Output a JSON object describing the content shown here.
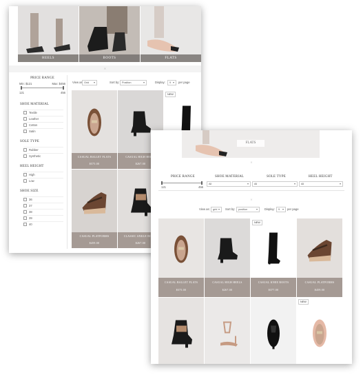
{
  "back": {
    "categories": [
      {
        "label": "HEELS",
        "bg": "#e2e0df"
      },
      {
        "label": "BOOTS",
        "bg": "#bdb7b2"
      },
      {
        "label": "FLATS",
        "bg": "#e8e7e6"
      }
    ],
    "price_range": {
      "title": "PRICE RANGE",
      "min_label": "Min: $121",
      "max_label": "Max: $456",
      "min": "121",
      "max": "456"
    },
    "toolbar": {
      "view_as": "View as:",
      "view_value": "Grid",
      "sort_by": "Sort by:",
      "sort_value": "Position",
      "display": "Display:",
      "display_value": "9",
      "per_page": "per page"
    },
    "filters": [
      {
        "title": "SHOE MATERIAL",
        "options": [
          "Textile",
          "Leather",
          "Cotton",
          "Satin"
        ]
      },
      {
        "title": "SOLE TYPE",
        "options": [
          "Rubber",
          "Synthetic"
        ]
      },
      {
        "title": "HEEL HEIGHT",
        "options": [
          "High",
          "Low"
        ]
      },
      {
        "title": "SHOE SIZE",
        "options": [
          "36",
          "37",
          "38",
          "39",
          "40"
        ]
      }
    ],
    "products": [
      {
        "name": "CASUAL BALLET FLATS",
        "price": "$575.00",
        "bg": "#e4e1df",
        "shoe": "#7a5138",
        "shape": "flat"
      },
      {
        "name": "CASUAL HIGH HEELS",
        "price": "$267.00",
        "bg": "#d9d7d6",
        "shoe": "#1a1a1a",
        "shape": "bootie"
      },
      {
        "name": "",
        "price": "",
        "bg": "#ffffff",
        "shoe": "#111111",
        "shape": "tallboot",
        "badge": "NEW"
      },
      {
        "name": "CASUAL PLATFORMS",
        "price": "$459.00",
        "bg": "#d7d3d0",
        "shoe": "#6b4632",
        "shape": "wedge"
      },
      {
        "name": "CLASSIC ANKLE BOOTS",
        "price": "$267.00",
        "bg": "#e1dedc",
        "shoe": "#1a1a1a",
        "shape": "ankle"
      }
    ]
  },
  "front": {
    "banner_label": "FLATS",
    "filter_bar": {
      "price_range": {
        "title": "PRICE RANGE",
        "min": "121",
        "max": "456"
      },
      "shoe_material": {
        "title": "SHOE MATERIAL",
        "value": "All"
      },
      "sole_type": {
        "title": "SOLE TYPE",
        "value": "All"
      },
      "heel_height": {
        "title": "HEEL HEIGHT",
        "value": "All"
      }
    },
    "toolbar": {
      "view_as": "View as:",
      "view_value": "grid",
      "sort_by": "Sort by:",
      "sort_value": "position",
      "display": "Display:",
      "display_value": "9",
      "per_page": "per page"
    },
    "products": [
      {
        "name": "CASUAL BALLET FLATS",
        "price": "$575.00",
        "bg": "#e8e5e3",
        "shoe": "#7a5138",
        "shape": "flat"
      },
      {
        "name": "CASUAL HIGH HEELS",
        "price": "$267.00",
        "bg": "#dcdad9",
        "shoe": "#1a1a1a",
        "shape": "bootie"
      },
      {
        "name": "CASUAL KNEE BOOTS",
        "price": "$377.00",
        "bg": "#ffffff",
        "shoe": "#111111",
        "shape": "tallboot",
        "badge": "NEW"
      },
      {
        "name": "CASUAL PLATFORMS",
        "price": "$459.00",
        "bg": "#e3dfdc",
        "shoe": "#6b4632",
        "shape": "wedge"
      },
      {
        "name": "",
        "price": "",
        "bg": "#e6e3e1",
        "shoe": "#1a1a1a",
        "shape": "ankle"
      },
      {
        "name": "",
        "price": "",
        "bg": "#ebe9e8",
        "shoe": "#c69b83",
        "shape": "strappy"
      },
      {
        "name": "",
        "price": "",
        "bg": "#f2f2f2",
        "shoe": "#111111",
        "shape": "oxford"
      },
      {
        "name": "",
        "price": "",
        "bg": "#ffffff",
        "shoe": "#e5b9a6",
        "shape": "flat",
        "badge": "NEW"
      }
    ]
  }
}
